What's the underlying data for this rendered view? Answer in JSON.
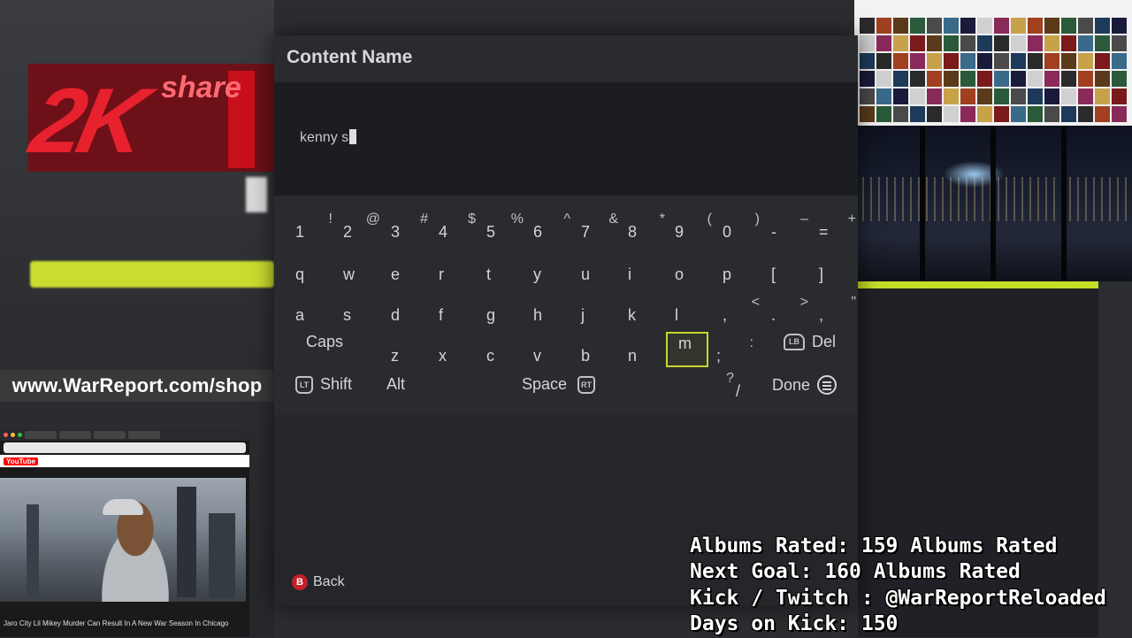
{
  "dialog": {
    "title": "Content Name",
    "input_value": "kenny s",
    "back_label": "Back",
    "back_button_glyph": "B"
  },
  "keyboard": {
    "rows": [
      [
        {
          "m": "1",
          "s": "!"
        },
        {
          "m": "2",
          "s": "@"
        },
        {
          "m": "3",
          "s": "#"
        },
        {
          "m": "4",
          "s": "$"
        },
        {
          "m": "5",
          "s": "%"
        },
        {
          "m": "6",
          "s": "^"
        },
        {
          "m": "7",
          "s": "&"
        },
        {
          "m": "8",
          "s": "*"
        },
        {
          "m": "9",
          "s": "("
        },
        {
          "m": "0",
          "s": ")"
        },
        {
          "m": "-",
          "s": "–"
        },
        {
          "m": "=",
          "s": "+"
        }
      ],
      [
        {
          "m": "q",
          "s": ""
        },
        {
          "m": "w",
          "s": ""
        },
        {
          "m": "e",
          "s": ""
        },
        {
          "m": "r",
          "s": ""
        },
        {
          "m": "t",
          "s": ""
        },
        {
          "m": "y",
          "s": ""
        },
        {
          "m": "u",
          "s": ""
        },
        {
          "m": "i",
          "s": ""
        },
        {
          "m": "o",
          "s": ""
        },
        {
          "m": "p",
          "s": ""
        },
        {
          "m": "[",
          "s": ""
        },
        {
          "m": "]",
          "s": ""
        }
      ],
      [
        {
          "m": "a",
          "s": ""
        },
        {
          "m": "s",
          "s": ""
        },
        {
          "m": "d",
          "s": ""
        },
        {
          "m": "f",
          "s": ""
        },
        {
          "m": "g",
          "s": ""
        },
        {
          "m": "h",
          "s": ""
        },
        {
          "m": "j",
          "s": ""
        },
        {
          "m": "k",
          "s": ""
        },
        {
          "m": "l",
          "s": ""
        },
        {
          "m": ",",
          "s": "<"
        },
        {
          "m": ".",
          "s": ">"
        },
        {
          "m": ",",
          "s": "\""
        }
      ],
      [
        {
          "m": "z",
          "s": ""
        },
        {
          "m": "x",
          "s": ""
        },
        {
          "m": "c",
          "s": ""
        },
        {
          "m": "v",
          "s": ""
        },
        {
          "m": "b",
          "s": ""
        },
        {
          "m": "n",
          "s": ""
        },
        {
          "m": "m",
          "s": "",
          "selected": true
        },
        {
          "m": ";",
          "s": ":"
        }
      ]
    ],
    "caps_label": "Caps",
    "del_label": "Del",
    "del_icon": "LB",
    "shift_label": "Shift",
    "shift_icon": "LT",
    "alt_label": "Alt",
    "space_label": "Space",
    "space_icon": "RT",
    "slash_key": {
      "m": "/",
      "s": "?"
    },
    "done_label": "Done",
    "accent_color": "#c7d72a"
  },
  "background": {
    "share_logo_text": "share",
    "share_logo_mark": "2K",
    "promo_text": "www.WarReport.com/shop"
  },
  "browser": {
    "youtube_label": "YouTube",
    "video_caption": "Jaro City Lil Mikey Murder Can Result In A New War Season In Chicago"
  },
  "stats": {
    "line1": "Albums Rated: 159 Albums Rated",
    "line2": "Next Goal: 160 Albums Rated",
    "line3": "Kick / Twitch : @WarReportReloaded",
    "line4": "Days on Kick: 150"
  }
}
